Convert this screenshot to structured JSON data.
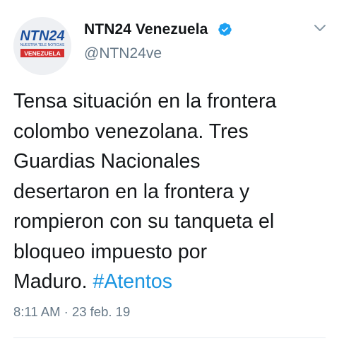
{
  "account": {
    "display_name": "NTN24 Venezuela",
    "handle": "@NTN24ve",
    "verified": true,
    "avatar": {
      "logo_text": "NTN24",
      "tagline": "NUESTRA TELE NOTICIAS",
      "region": "VENEZUELA"
    }
  },
  "tweet": {
    "text_lines": [
      "Tensa situación en la frontera",
      "colombo venezolana. Tres",
      "Guardias Nacionales",
      "desertaron en la frontera y",
      "rompieron con su tanqueta el",
      "bloqueo impuesto por"
    ],
    "last_line_text": "Maduro. ",
    "hashtag": "#Atentos",
    "timestamp": "8:11 AM · 23 feb. 19"
  },
  "colors": {
    "text": "#14171a",
    "secondary": "#657786",
    "link": "#1b95e0",
    "verified": "#1da1f2",
    "brand_blue": "#1b4f9c",
    "brand_red": "#d32f2f"
  },
  "icons": {
    "verified": "verified-badge-icon",
    "caret": "chevron-down-icon"
  }
}
